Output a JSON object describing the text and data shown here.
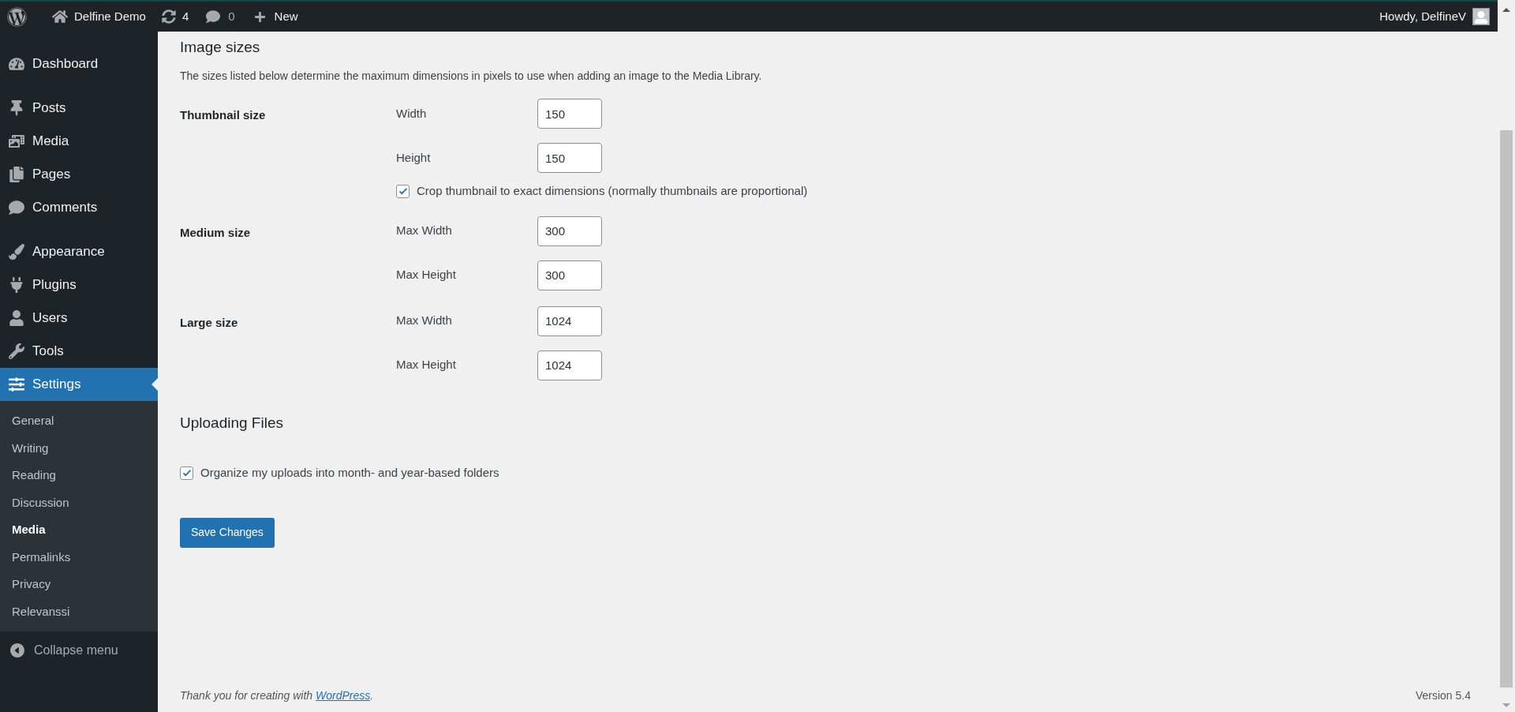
{
  "top_bar": {
    "site": "Delfine Demo",
    "updates": "4",
    "comments": "0",
    "new": "New",
    "greeting": "Howdy, DelfineV"
  },
  "sidebar": {
    "items": [
      {
        "label": "Dashboard",
        "selected": false
      },
      {
        "label": "Posts",
        "selected": false
      },
      {
        "label": "Media",
        "selected": false
      },
      {
        "label": "Pages",
        "selected": false
      },
      {
        "label": "Comments",
        "selected": false
      },
      {
        "label": "Appearance",
        "selected": false
      },
      {
        "label": "Plugins",
        "selected": false
      },
      {
        "label": "Users",
        "selected": false
      },
      {
        "label": "Tools",
        "selected": false
      },
      {
        "label": "Settings",
        "selected": true,
        "children": [
          {
            "label": "General",
            "selected": false
          },
          {
            "label": "Writing",
            "selected": false
          },
          {
            "label": "Reading",
            "selected": false
          },
          {
            "label": "Discussion",
            "selected": false
          },
          {
            "label": "Media",
            "selected": true
          },
          {
            "label": "Permalinks",
            "selected": false
          },
          {
            "label": "Privacy",
            "selected": false
          },
          {
            "label": "Relevanssi",
            "selected": false
          }
        ]
      }
    ],
    "collapse": "Collapse menu"
  },
  "image_sizes": {
    "title": "Image sizes",
    "description": "The sizes listed below determine the maximum dimensions in pixels to use when adding an image to the Media Library.",
    "groups": [
      {
        "label": "Thumbnail size",
        "fields": [
          {
            "label": "Width",
            "value": "150"
          },
          {
            "label": "Height",
            "value": "150"
          }
        ],
        "checkbox": {
          "label": "Crop thumbnail to exact dimensions (normally thumbnails are proportional)",
          "checked": true
        }
      },
      {
        "label": "Medium size",
        "fields": [
          {
            "label": "Max Width",
            "value": "300"
          },
          {
            "label": "Max Height",
            "value": "300"
          }
        ]
      },
      {
        "label": "Large size",
        "fields": [
          {
            "label": "Max Width",
            "value": "1024"
          },
          {
            "label": "Max Height",
            "value": "1024"
          }
        ]
      }
    ]
  },
  "uploading": {
    "title": "Uploading Files",
    "checkbox": {
      "label": "Organize my uploads into month- and year-based folders",
      "checked": true
    }
  },
  "save_button": "Save Changes",
  "footer": {
    "text": "Thank you for creating with ",
    "link": "WordPress",
    "after": ".",
    "version": "Version 5.4"
  }
}
